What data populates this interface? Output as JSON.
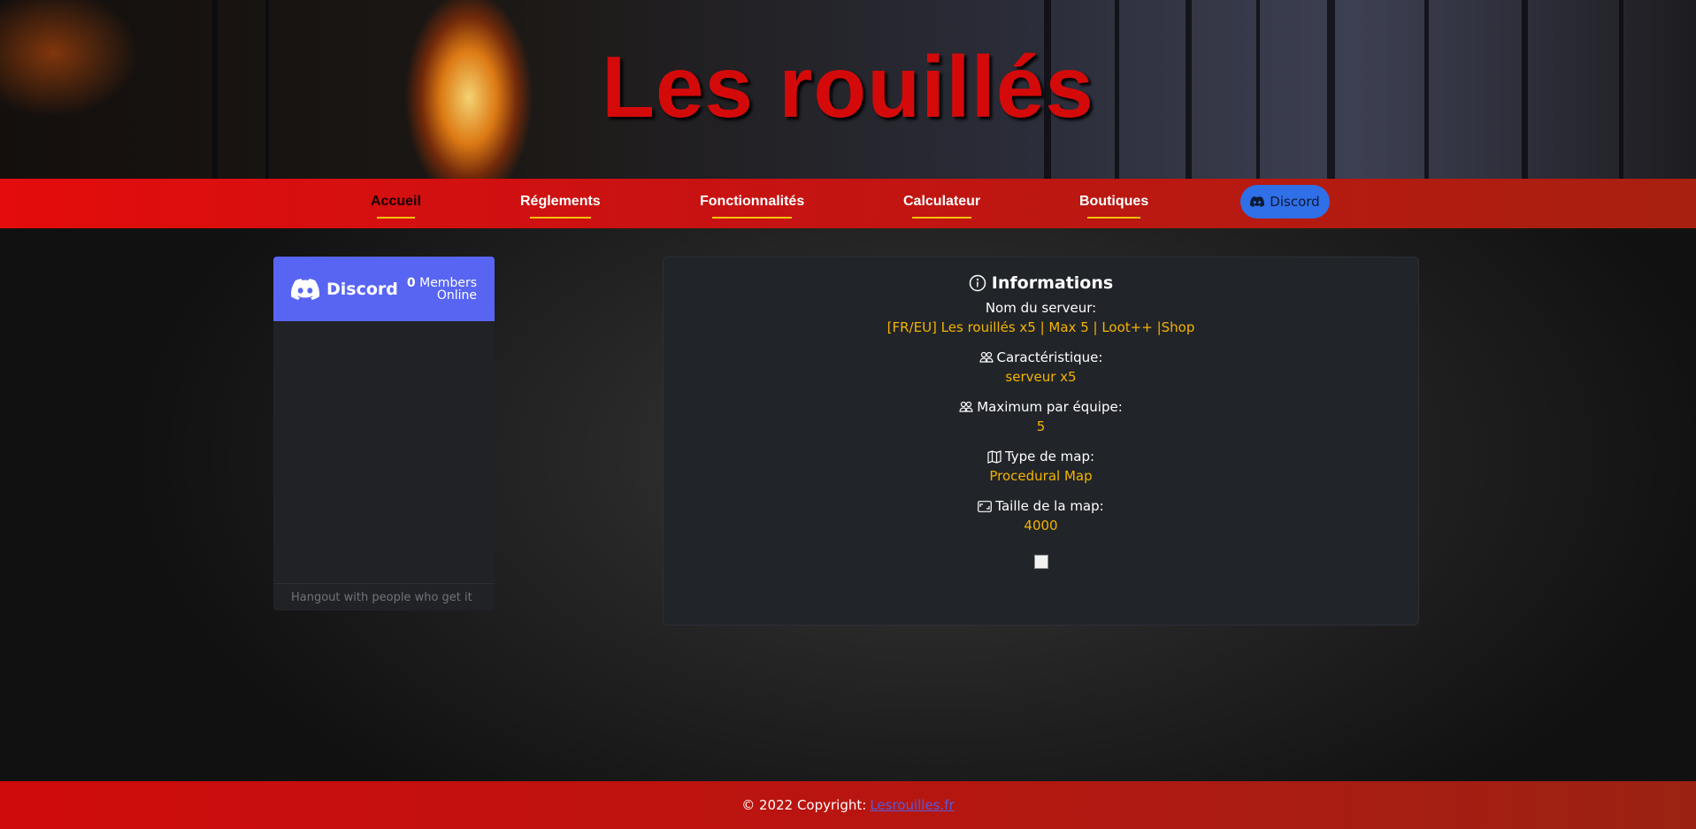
{
  "header": {
    "title": "Les rouillés"
  },
  "nav": {
    "items": [
      {
        "label": "Accueil",
        "active": true
      },
      {
        "label": "Réglements"
      },
      {
        "label": "Fonctionnalités"
      },
      {
        "label": "Calculateur"
      },
      {
        "label": "Boutiques"
      }
    ],
    "discord_button": {
      "label": "Discord",
      "icon": "discord-icon",
      "color": "#2f6fe8"
    }
  },
  "discord_widget": {
    "brand": "Discord",
    "members_count": "0",
    "members_label_1": "Members",
    "members_label_2": "Online",
    "footer_text": "Hangout with people who get it",
    "header_color": "#5865f2"
  },
  "info_card": {
    "title": "Informations",
    "title_icon": "info-circle-icon",
    "groups": [
      {
        "label": "Nom du serveur:",
        "value": "[FR/EU] Les rouillés x5 | Max 5 | Loot++ |Shop",
        "icon": ""
      },
      {
        "label": "Caractéristique:",
        "value": "serveur x5",
        "icon": "people-icon"
      },
      {
        "label": "Maximum par équipe:",
        "value": "5",
        "icon": "people-icon"
      },
      {
        "label": "Type de map:",
        "value": "Procedural Map",
        "icon": "map-icon"
      },
      {
        "label": "Taille de la map:",
        "value": "4000",
        "icon": "aspect-ratio-icon"
      }
    ],
    "value_color": "#f4b400"
  },
  "footer": {
    "copyright": "© 2022 Copyright:",
    "link_label": "Lesrouilles.fr"
  }
}
